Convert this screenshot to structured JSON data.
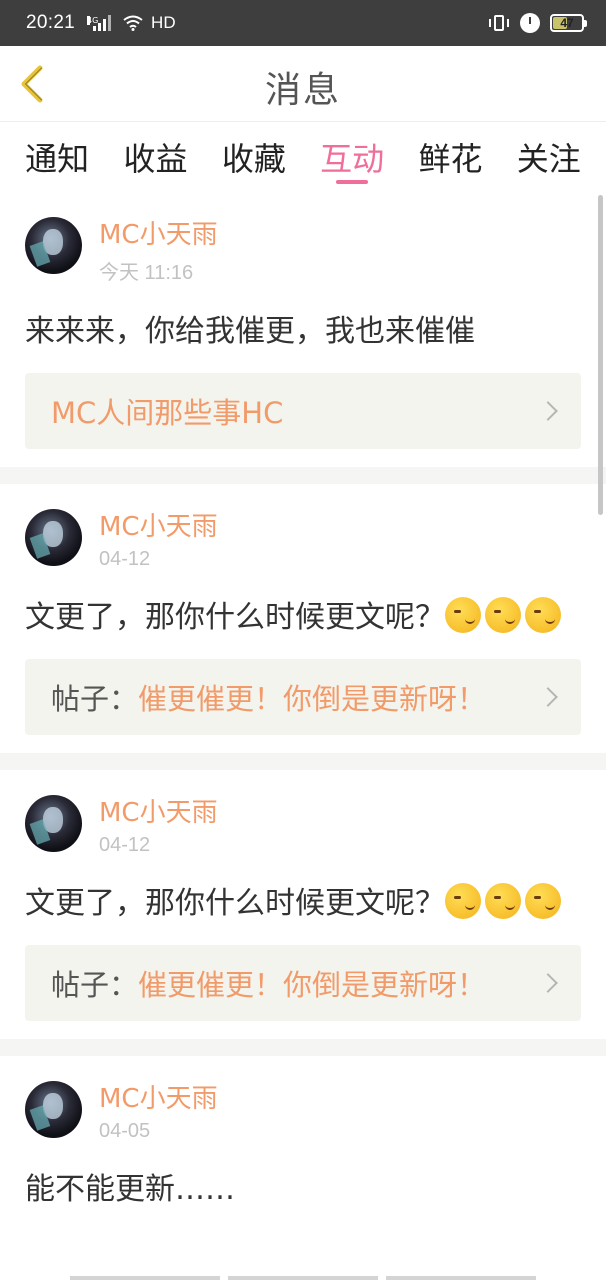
{
  "status_bar": {
    "time": "20:21",
    "network": "4G",
    "hd": "HD",
    "battery": "47"
  },
  "header": {
    "title": "消息"
  },
  "tabs": [
    {
      "label": "通知",
      "active": false
    },
    {
      "label": "收益",
      "active": false
    },
    {
      "label": "收藏",
      "active": false
    },
    {
      "label": "互动",
      "active": true
    },
    {
      "label": "鲜花",
      "active": false
    },
    {
      "label": "关注",
      "active": false
    }
  ],
  "messages": [
    {
      "user": "MC小天雨",
      "time": "今天 11:16",
      "text": "来来来，你给我催更，我也来催催",
      "emoji_count": 0,
      "ref_prefix": "",
      "ref_title": "MC人间那些事HC"
    },
    {
      "user": "MC小天雨",
      "time": "04-12",
      "text": "文更了，那你什么时候更文呢？",
      "emoji_count": 3,
      "ref_prefix": "帖子：",
      "ref_title": "催更催更！你倒是更新呀！"
    },
    {
      "user": "MC小天雨",
      "time": "04-12",
      "text": "文更了，那你什么时候更文呢？",
      "emoji_count": 3,
      "ref_prefix": "帖子：",
      "ref_title": "催更催更！你倒是更新呀！"
    },
    {
      "user": "MC小天雨",
      "time": "04-05",
      "text": "能不能更新……",
      "emoji_count": 0,
      "ref_prefix": "",
      "ref_title": ""
    }
  ],
  "colors": {
    "accent": "#ef6e9b",
    "username": "#f29b6a",
    "status_bar": "#3e3e3e"
  },
  "icons": {
    "back": "chevron-left-icon",
    "ref_arrow": "chevron-right-icon"
  }
}
